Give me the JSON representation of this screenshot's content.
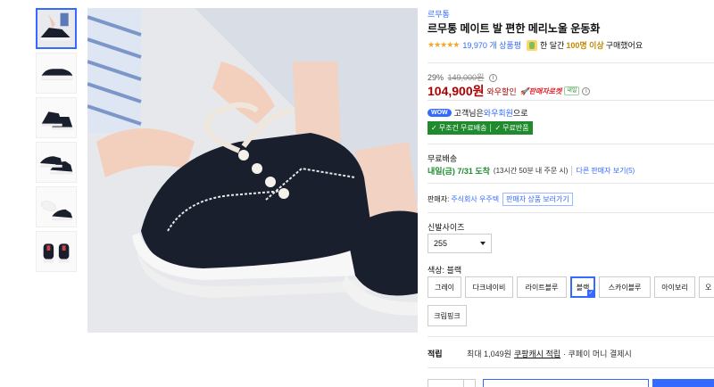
{
  "product": {
    "brand": "르무통",
    "title": "르무통 메이트 발 편한 메리노울 운동화",
    "stars": "★★★★★",
    "review_count": "19,970 개 상품평",
    "buyers_prefix": "한 달간",
    "buyers_count": "100명 이상",
    "buyers_suffix": "구매했어요"
  },
  "price": {
    "discount_rate": "29%",
    "original_price": "149,000원",
    "info_icon": "ⓘ",
    "sale_price": "104,900원",
    "wow_sale_label": "와우할인",
    "rocket_label": "판매자로켓",
    "tiny_badge": "내일"
  },
  "wow": {
    "pill": "WOW",
    "text_prefix": "고객님은",
    "member": "와우회원",
    "text_suffix": "으로",
    "benefit_1": "무조건 무료배송",
    "benefit_2": "무료반품",
    "check": "✓"
  },
  "shipping": {
    "label": "무료배송",
    "date": "내일(금) 7/31 도착",
    "note": "(13시간 50분 내 주문 시)",
    "other_sellers_link": "다른 판매자 보기(5)"
  },
  "seller": {
    "label": "판매자:",
    "name": "주식회사 우주텍",
    "button": "판매자 상품 보러가기"
  },
  "size": {
    "label": "신발사이즈",
    "selected": "255"
  },
  "color": {
    "label": "색상: 블랙",
    "options": [
      "그레이",
      "다크네이비",
      "라이트블루",
      "블랙",
      "스카이블루",
      "아이보리",
      "오",
      "크림핑크"
    ],
    "selected_index": 3,
    "tick": "✓"
  },
  "points": {
    "label": "적립",
    "text_prefix": "최대 1,049원",
    "link": "쿠팡캐시 적립",
    "text_suffix": "· 쿠페이 머니 결제시"
  },
  "colors": {
    "accent": "#346aff",
    "price_red": "#ae0000",
    "green": "#1f8a2e",
    "shoe_black": "#1a1f2e"
  }
}
